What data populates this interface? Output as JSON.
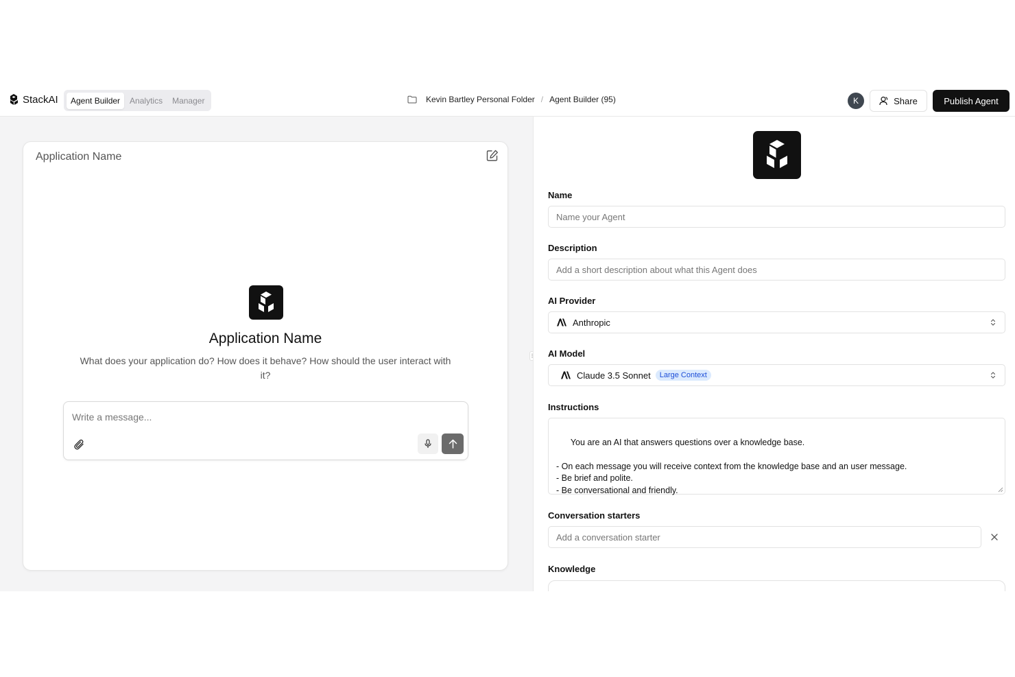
{
  "header": {
    "brand": "StackAI",
    "tabs": [
      {
        "label": "Agent Builder",
        "active": true
      },
      {
        "label": "Analytics",
        "active": false
      },
      {
        "label": "Manager",
        "active": false
      }
    ],
    "breadcrumb": {
      "folder": "Kevin Bartley Personal Folder",
      "separator": "/",
      "current": "Agent Builder (95)"
    },
    "avatar_initial": "K",
    "share_label": "Share",
    "publish_label": "Publish Agent"
  },
  "preview": {
    "card_title": "Application Name",
    "app_name": "Application Name",
    "app_description": "What does your application do? How does it behave? How should the user interact with it?",
    "message_placeholder": "Write a message..."
  },
  "form": {
    "name": {
      "label": "Name",
      "placeholder": "Name your Agent"
    },
    "description": {
      "label": "Description",
      "placeholder": "Add a short description about what this Agent does"
    },
    "provider": {
      "label": "AI Provider",
      "value": "Anthropic",
      "icon": "anthropic-icon"
    },
    "model": {
      "label": "AI Model",
      "value": "Claude 3.5 Sonnet",
      "badge": "Large Context",
      "icon": "anthropic-icon"
    },
    "instructions": {
      "label": "Instructions",
      "value": "You are an AI that answers questions over a knowledge base.\n\n- On each message you will receive context from the knowledge base and an user message.\n- Be brief and polite.\n- Be conversational and friendly."
    },
    "starters": {
      "label": "Conversation starters",
      "placeholder": "Add a conversation starter"
    },
    "knowledge": {
      "label": "Knowledge"
    }
  },
  "colors": {
    "accent": "#111111",
    "badge_bg": "#dbeafe",
    "badge_text": "#1d4ed8",
    "canvas_bg": "#f4f4f5"
  }
}
